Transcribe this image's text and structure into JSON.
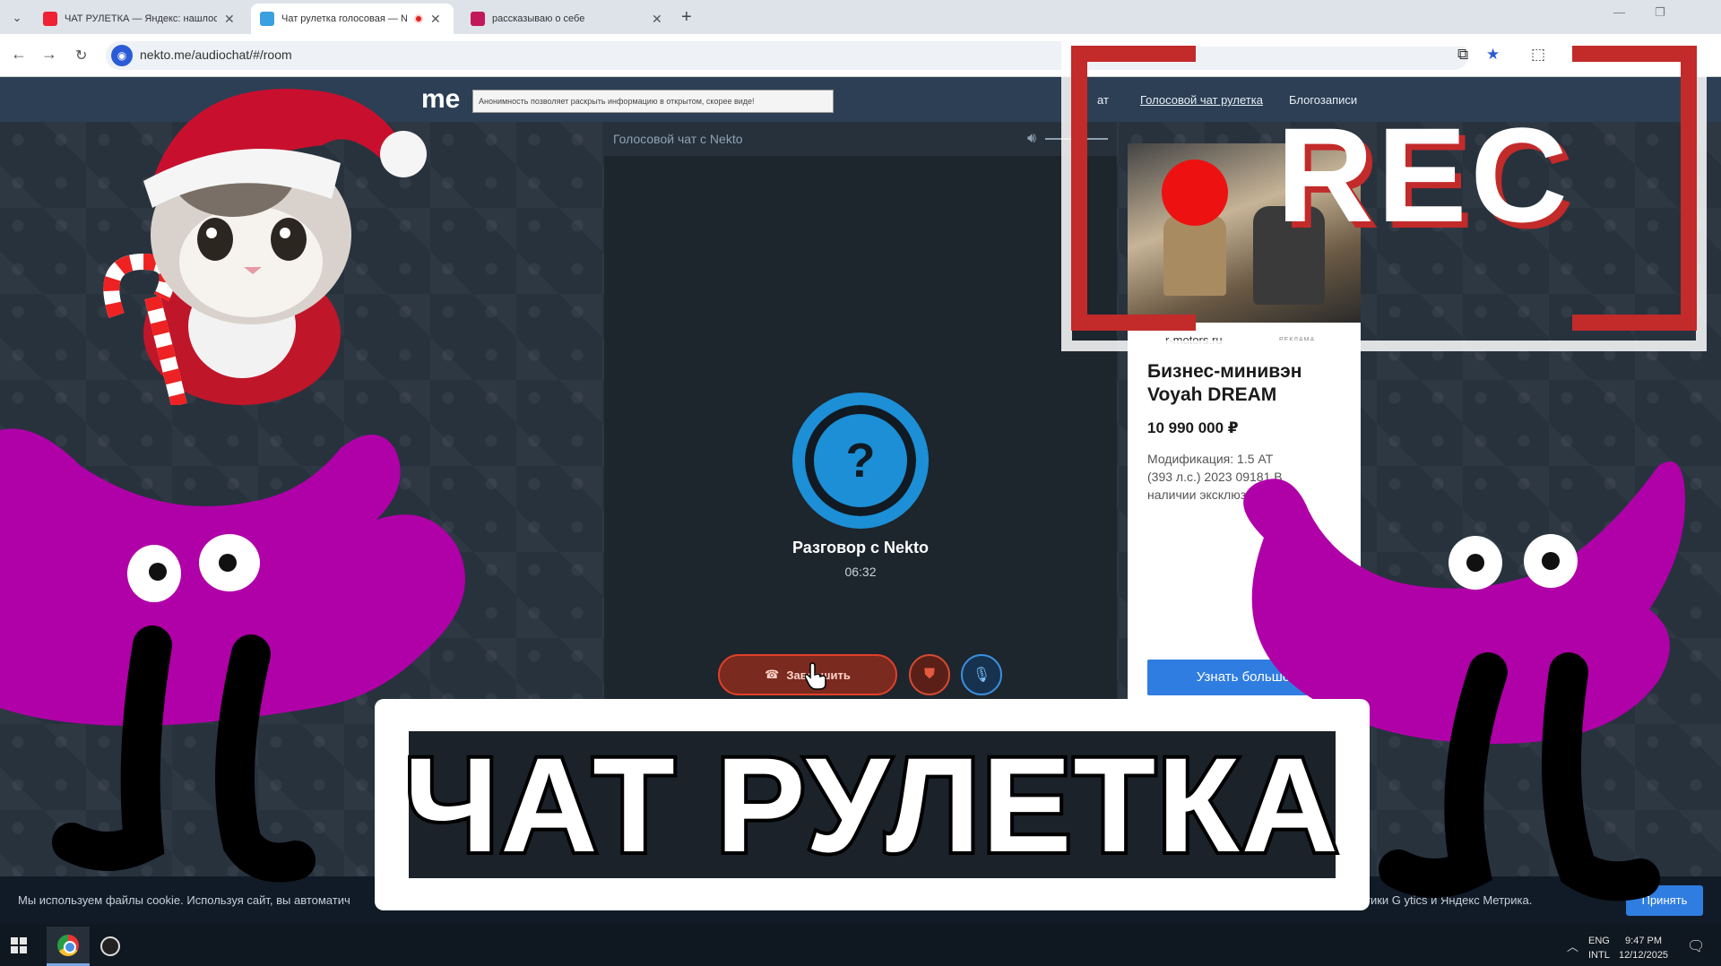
{
  "browser": {
    "tabs": [
      {
        "title": "ЧАТ РУЛЕТКА — Яндекс: нашлось",
        "active": false
      },
      {
        "title": "Чат рулетка голосовая — Nekto",
        "active": true
      },
      {
        "title": "рассказываю о себе",
        "active": false
      }
    ],
    "new_tab": "+",
    "url": "nekto.me/audiochat/#/room"
  },
  "site": {
    "logo": "me",
    "notice": "Анонимность позволяет раскрыть информацию в открытом, скорее виде!",
    "nav": [
      "ат",
      "Голосовой чат рулетка",
      "Блогозаписи"
    ]
  },
  "chat": {
    "header": "Голосовой чат с Nekto",
    "call_name": "Разговор с Nekto",
    "call_time": "06:32",
    "end_call_label": "Завершить"
  },
  "ad": {
    "domain": "r-motors.ru",
    "tag": "РЕКЛАМА",
    "title": "Бизнес-минивэн Voyah DREAM",
    "price": "10 990 000 ₽",
    "description": "Модификация: 1.5 AT (393 л.с.) 2023 09181 В наличии эксклюзивн",
    "button": "Узнать больше"
  },
  "cookie": {
    "text_left": "Мы используем файлы cookie. Используя сайт, вы автоматич",
    "text_right": "тики G     ytics и Яндекс Метрика.",
    "accept": "Принять"
  },
  "taskbar": {
    "lang_1": "ENG",
    "lang_2": "INTL",
    "time": "9:47 PM",
    "date": "12/12/2025"
  },
  "thumbnail": {
    "rec_label": "REC",
    "title": "ЧАТ РУЛЕТКА"
  },
  "colors": {
    "purple": "#b000a8",
    "rec_red": "#ee1111",
    "accent_blue": "#2f7de1",
    "call_blue": "#1c8fd6"
  }
}
